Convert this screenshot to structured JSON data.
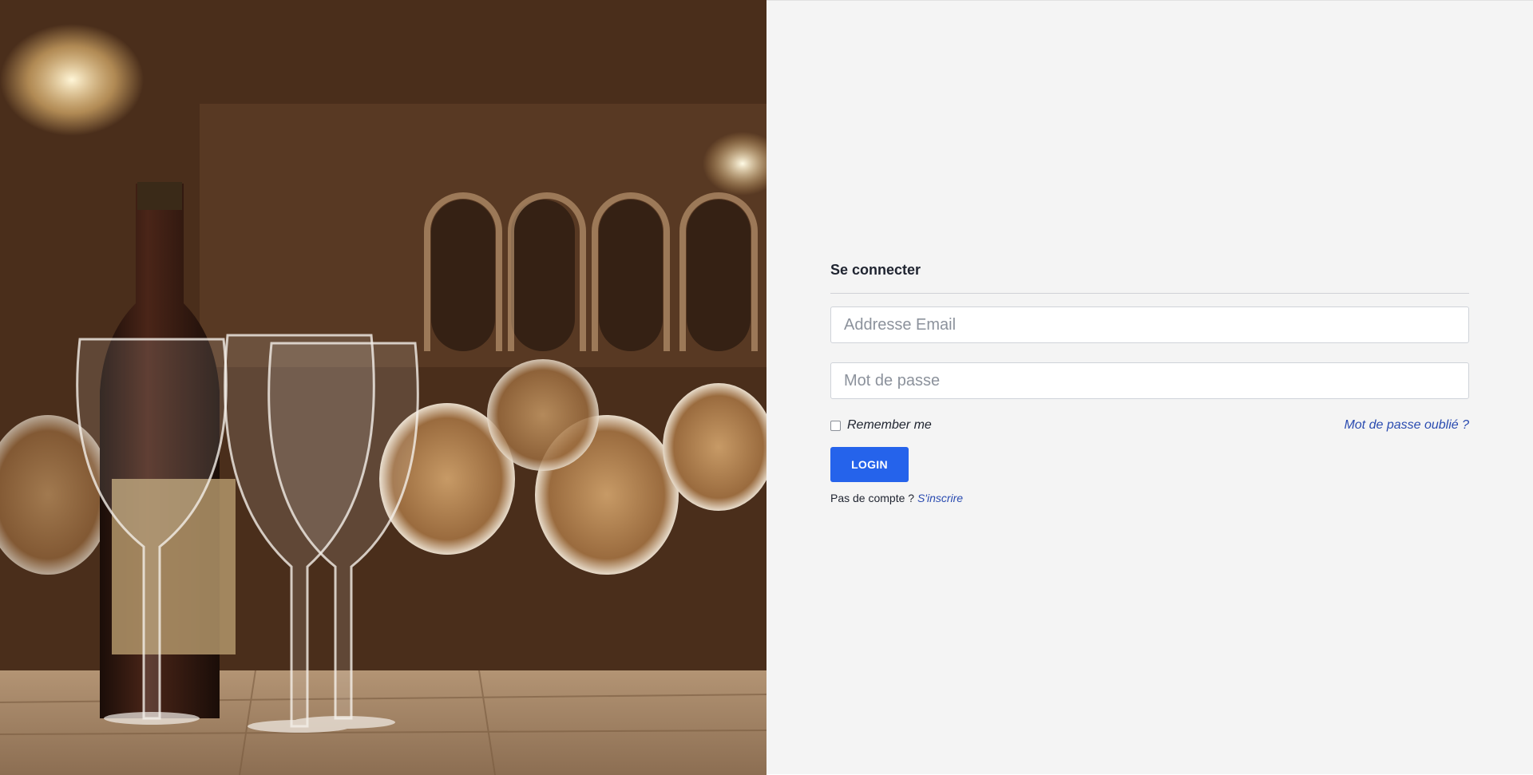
{
  "hero": {
    "image_icon": "wine-cellar-photo"
  },
  "login": {
    "title": "Se connecter",
    "email_placeholder": "Addresse Email",
    "email_value": "",
    "password_placeholder": "Mot de passe",
    "password_value": "",
    "remember_label": "Remember me",
    "remember_checked": false,
    "forgot_link": "Mot de passe oublié ?",
    "submit_label": "LOGIN",
    "no_account_text": "Pas de compte ?",
    "signup_link": "S'inscrire"
  },
  "colors": {
    "accent": "#2563eb",
    "link": "#2a4bb0",
    "panel_bg": "#f4f4f4"
  }
}
